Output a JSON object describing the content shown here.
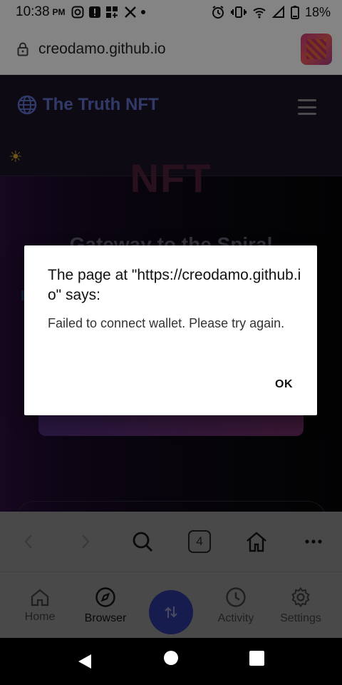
{
  "status_bar": {
    "time": "10:38",
    "ampm": "PM",
    "battery": "18%"
  },
  "browser": {
    "url": "creodamo.github.io",
    "tab_count": "4"
  },
  "site": {
    "title": "The Truth NFT",
    "hero_heading": "NFT",
    "hero_subtitle": "Gateway to the Spiral"
  },
  "dialog": {
    "title": "The page at \"https://creodamo.github.io\" says:",
    "message": "Failed to connect wallet. Please try again.",
    "ok_label": "OK"
  },
  "bottom_nav": {
    "items": [
      {
        "label": "Home"
      },
      {
        "label": "Browser"
      },
      {
        "label": "Activity"
      },
      {
        "label": "Settings"
      }
    ]
  },
  "colors": {
    "accent": "#2b3390",
    "site_title": "#5a6ac0"
  }
}
